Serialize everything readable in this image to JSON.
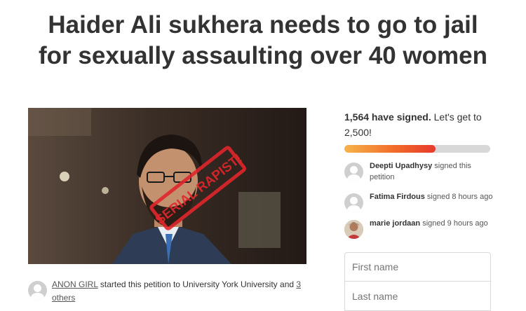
{
  "petition": {
    "title_line1": "Haider Ali sukhera needs to go to jail",
    "title_line2": "for sexually assaulting over 40 women",
    "image_stamp_text": "SERIAL RAPIST!",
    "starter": {
      "name": "ANON GIRL",
      "text": " started this petition to University York University and ",
      "others": "3 others"
    }
  },
  "progress": {
    "signed_bold": "1,564 have signed.",
    "goal_text": " Let's get to 2,500!",
    "signed": 1564,
    "goal": 2500
  },
  "recent_signers": [
    {
      "name": "Deepti Upadhysy",
      "action": " signed this petition",
      "avatar": "default-avatar"
    },
    {
      "name": "Fatima Firdous",
      "action": " signed 8 hours ago",
      "avatar": "default-avatar"
    },
    {
      "name": "marie jordaan",
      "action": " signed 9 hours ago",
      "avatar": "photo-avatar"
    }
  ],
  "form": {
    "first_name_placeholder": "First name",
    "last_name_placeholder": "Last name"
  },
  "colors": {
    "progress_start": "#f6b44a",
    "progress_end": "#e63a2b",
    "stamp_red": "#e0262b"
  }
}
